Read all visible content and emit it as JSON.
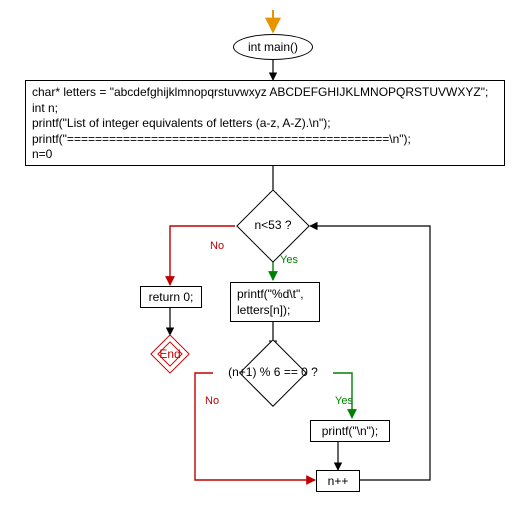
{
  "chart_data": {
    "type": "flowchart",
    "title": "",
    "nodes": [
      {
        "id": "start",
        "kind": "start-arrow",
        "label": ""
      },
      {
        "id": "main",
        "kind": "ellipse",
        "label": "int main()"
      },
      {
        "id": "decl",
        "kind": "process",
        "lines": [
          "char* letters = \"abcdefghijklmnopqrstuvwxyz ABCDEFGHIJKLMNOPQRSTUVWXYZ\";",
          "int n;",
          "printf(\"List of integer equivalents of letters (a-z, A-Z).\\n\");",
          "printf(\"==============================================\\n\");",
          "n=0"
        ]
      },
      {
        "id": "cond1",
        "kind": "decision",
        "label": "n<53 ?"
      },
      {
        "id": "print_num",
        "kind": "process",
        "lines": [
          "printf(\"%d\\t\",",
          "letters[n]);"
        ]
      },
      {
        "id": "cond2",
        "kind": "decision",
        "label": "(n+1) % 6 == 0 ?"
      },
      {
        "id": "print_nl",
        "kind": "process",
        "lines": [
          "printf(\"\\n\");"
        ]
      },
      {
        "id": "incr",
        "kind": "process",
        "lines": [
          "n++"
        ]
      },
      {
        "id": "ret",
        "kind": "process",
        "lines": [
          "return 0;"
        ]
      },
      {
        "id": "end",
        "kind": "terminator",
        "label": "End"
      }
    ],
    "edges": [
      {
        "from": "start",
        "to": "main"
      },
      {
        "from": "main",
        "to": "decl"
      },
      {
        "from": "decl",
        "to": "cond1"
      },
      {
        "from": "cond1",
        "to": "print_num",
        "label": "Yes"
      },
      {
        "from": "cond1",
        "to": "ret",
        "label": "No"
      },
      {
        "from": "print_num",
        "to": "cond2"
      },
      {
        "from": "cond2",
        "to": "print_nl",
        "label": "Yes"
      },
      {
        "from": "cond2",
        "to": "incr",
        "label": "No"
      },
      {
        "from": "print_nl",
        "to": "incr"
      },
      {
        "from": "incr",
        "to": "cond1"
      },
      {
        "from": "ret",
        "to": "end"
      }
    ]
  },
  "nodes": {
    "main_label": "int main()",
    "decl_line1": "char* letters = \"abcdefghijklmnopqrstuvwxyz ABCDEFGHIJKLMNOPQRSTUVWXYZ\";",
    "decl_line2": "int n;",
    "decl_line3": "printf(\"List of integer equivalents of letters (a-z, A-Z).\\n\");",
    "decl_line4": "printf(\"==============================================\\n\");",
    "decl_line5": "n=0",
    "cond1_label": "n<53 ?",
    "print_num_line1": "printf(\"%d\\t\",",
    "print_num_line2": "letters[n]);",
    "cond2_label": "(n+1) % 6 == 0 ?",
    "print_nl_label": "printf(\"\\n\");",
    "incr_label": "n++",
    "ret_label": "return 0;",
    "end_label": "End"
  },
  "labels": {
    "yes": "Yes",
    "no": "No"
  }
}
